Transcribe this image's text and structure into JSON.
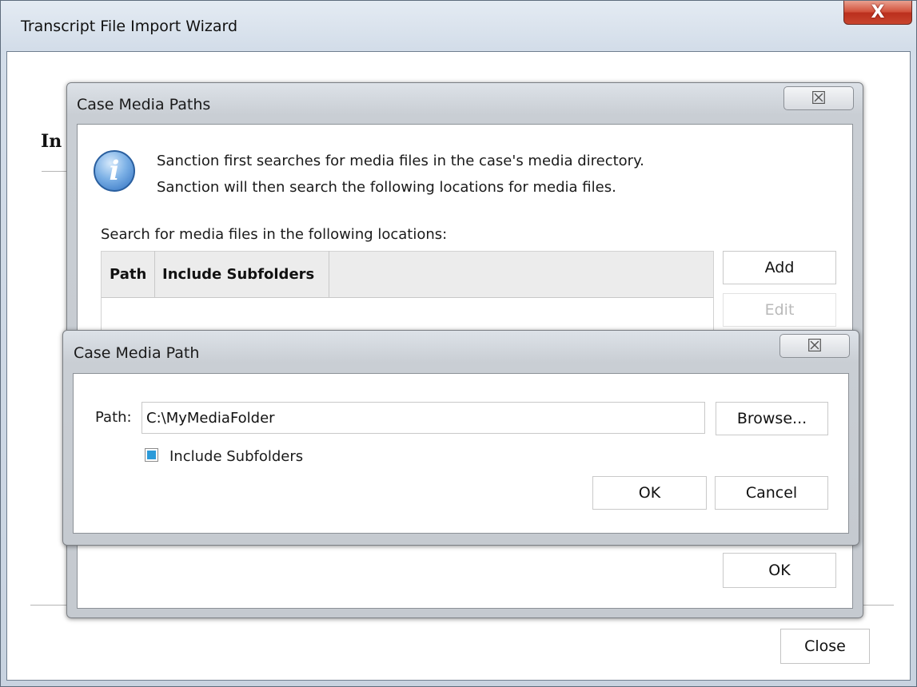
{
  "wizard": {
    "title": "Transcript File Import Wizard",
    "close_glyph": "X",
    "heading_partial": "In",
    "close_label": "Close"
  },
  "paths_dialog": {
    "title": "Case Media Paths",
    "close_glyph": "☒",
    "info_lines": [
      "Sanction first searches for media files in the case's media directory.",
      "Sanction will then search the following locations for media files."
    ],
    "list_label": "Search for media files in the following locations:",
    "columns": [
      "Path",
      "Include Subfolders"
    ],
    "buttons": {
      "add": "Add",
      "edit": "Edit",
      "ok": "OK"
    }
  },
  "path_dialog": {
    "title": "Case Media Path",
    "close_glyph": "☒",
    "path_label": "Path:",
    "path_value": "C:\\MyMediaFolder",
    "browse_label": "Browse...",
    "include_subfolders_label": "Include Subfolders",
    "include_subfolders_checked": true,
    "ok_label": "OK",
    "cancel_label": "Cancel"
  }
}
